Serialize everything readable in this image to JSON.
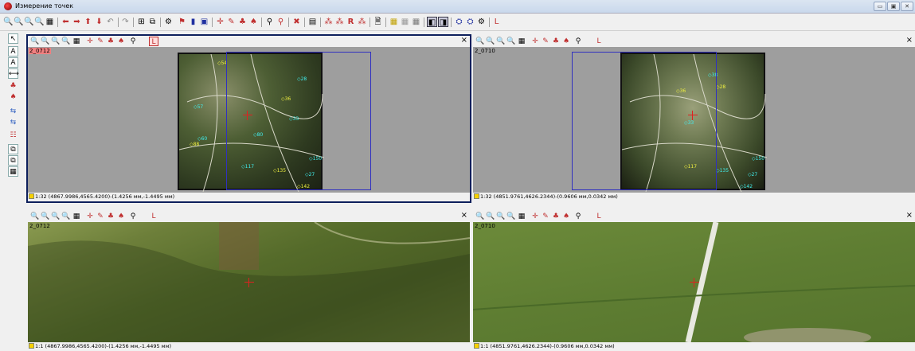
{
  "window": {
    "title": "Измерение точек",
    "controls": [
      "minimize",
      "maximize",
      "close"
    ]
  },
  "toolbar": {
    "icons": [
      "zoom-in-icon",
      "zoom-out-icon",
      "zoom-fit-icon",
      "zoom-all-icon",
      "grid-icon",
      "arrow-left-icon",
      "arrow-right-icon",
      "arrow-up-icon",
      "arrow-down-icon",
      "undo-icon",
      "redo-icon",
      "layout-icon",
      "sync-icon",
      "point-add-icon",
      "point-measure-icon",
      "point-delete-icon",
      "filter-icon",
      "close-red-icon",
      "table-icon",
      "R-icon",
      "report-icon",
      "save-icon",
      "layer-icon",
      "view-one-icon",
      "view-two-icon",
      "tool-icon",
      "settings-icon",
      "L-icon"
    ],
    "r_label": "R",
    "l_label": "L"
  },
  "panels": {
    "top_left": {
      "image_name": "2_0712",
      "status": "1:32 (4867.9986,4565.4200)-(1.4256 мм,-1.4495 мм)",
      "toggle_label": "L"
    },
    "top_right": {
      "image_name": "2_0710",
      "status": "1:32 (4851.9761,4626.2344)-(0.9606 мм,0.0342 мм)",
      "toggle_label": "L"
    },
    "bottom_left": {
      "image_name": "2_0712",
      "status": "1:1 (4867.9986,4565.4200)-(1.4256 мм,-1.4495 мм)",
      "toggle_label": "L"
    },
    "bottom_right": {
      "image_name": "2_0710",
      "status": "1:1 (4851.9761,4626.2344)-(0.9606 мм,0.0342 мм)",
      "toggle_label": "L"
    }
  },
  "points_left": [
    "54",
    "57",
    "33",
    "36",
    "28",
    "60",
    "88",
    "80",
    "150",
    "135",
    "117",
    "27",
    "142"
  ],
  "points_right": [
    "36",
    "33",
    "38",
    "28",
    "150",
    "135",
    "117",
    "27",
    "142"
  ],
  "close_symbol": "×"
}
